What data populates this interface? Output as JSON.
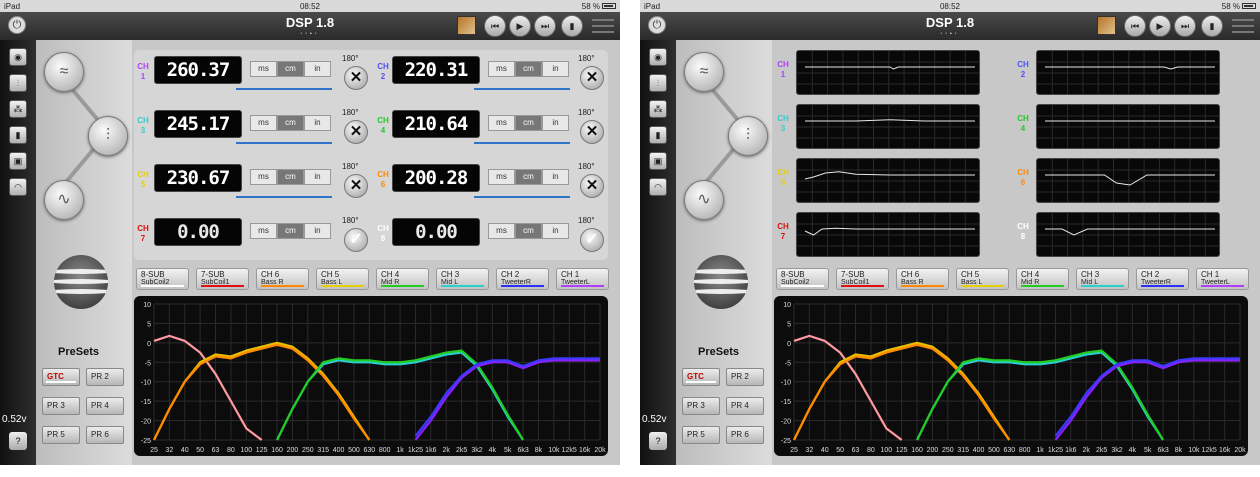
{
  "status": {
    "device": "iPad",
    "time": "08:52",
    "battery": "58 %"
  },
  "app": {
    "title": "DSP 1.8",
    "page_dots": [
      "•",
      "•",
      "•",
      "•"
    ]
  },
  "transport": {
    "prev": "⏮",
    "play": "▶",
    "next": "⏭",
    "extra": "▮"
  },
  "sidebar": {
    "voltage": "0.52v",
    "help": "?"
  },
  "presets": {
    "title": "PreSets",
    "items": [
      "GTC",
      "PR 2",
      "PR 3",
      "PR 4",
      "PR 5",
      "PR 6"
    ]
  },
  "delay": {
    "units": [
      "ms",
      "cm",
      "in"
    ],
    "phase": "180°",
    "channels": [
      {
        "ch": "CH",
        "num": "1",
        "value": "260.37",
        "color": "#b040ff"
      },
      {
        "ch": "CH",
        "num": "2",
        "value": "220.31",
        "color": "#5050ff"
      },
      {
        "ch": "CH",
        "num": "3",
        "value": "245.17",
        "color": "#2ad0d0"
      },
      {
        "ch": "CH",
        "num": "4",
        "value": "210.64",
        "color": "#22cc22"
      },
      {
        "ch": "CH",
        "num": "5",
        "value": "230.67",
        "color": "#e8d000"
      },
      {
        "ch": "CH",
        "num": "6",
        "value": "200.28",
        "color": "#ff8a00"
      },
      {
        "ch": "CH",
        "num": "7",
        "value": "0.00",
        "color": "#e01010"
      },
      {
        "ch": "CH",
        "num": "8",
        "value": "0.00",
        "color": "#ffffff"
      }
    ]
  },
  "tabs": [
    {
      "top": "8-SUB",
      "bottom": "SubCoil2",
      "color": "#ffffff"
    },
    {
      "top": "7-SUB",
      "bottom": "SubCoil1",
      "color": "#e01010"
    },
    {
      "top": "CH 6",
      "bottom": "Bass R",
      "color": "#ff8a00"
    },
    {
      "top": "CH 5",
      "bottom": "Bass L",
      "color": "#e8d000"
    },
    {
      "top": "CH 4",
      "bottom": "Mid R",
      "color": "#22cc22"
    },
    {
      "top": "CH 3",
      "bottom": "Mid L",
      "color": "#2ad0d0"
    },
    {
      "top": "CH 2",
      "bottom": "TweeterR",
      "color": "#3030ff"
    },
    {
      "top": "CH 1",
      "bottom": "TweeterL",
      "color": "#b040ff"
    }
  ],
  "chart_data": {
    "type": "line",
    "x_ticks": [
      "25",
      "32",
      "40",
      "50",
      "63",
      "80",
      "100",
      "125",
      "160",
      "200",
      "250",
      "315",
      "400",
      "500",
      "630",
      "800",
      "1k",
      "1k25",
      "1k6",
      "2k",
      "2k5",
      "3k2",
      "4k",
      "5k",
      "6k3",
      "8k",
      "10k",
      "12k5",
      "16k",
      "20k"
    ],
    "y_ticks": [
      10,
      5,
      0,
      -5,
      -10,
      -15,
      -20,
      -25
    ],
    "ylim": [
      -25,
      10
    ],
    "series": [
      {
        "color": "#ff9aa0",
        "points": [
          [
            0,
            0.5
          ],
          [
            1,
            1.8
          ],
          [
            2,
            0.5
          ],
          [
            3,
            -2.5
          ],
          [
            4,
            -8
          ],
          [
            5,
            -15
          ],
          [
            6,
            -22
          ],
          [
            7,
            -25
          ]
        ]
      },
      {
        "color": "#e8c000",
        "points": [
          [
            0,
            -25
          ],
          [
            1,
            -17
          ],
          [
            2,
            -10
          ],
          [
            3,
            -5
          ],
          [
            4,
            -3
          ],
          [
            5,
            -3.5
          ],
          [
            6,
            -2
          ],
          [
            7,
            -1
          ],
          [
            8,
            0
          ],
          [
            9,
            -1
          ],
          [
            10,
            -4
          ],
          [
            11,
            -8
          ],
          [
            12,
            -13
          ],
          [
            13,
            -19
          ],
          [
            14,
            -25
          ]
        ]
      },
      {
        "color": "#ff8a00",
        "points": [
          [
            0,
            -25
          ],
          [
            1,
            -17
          ],
          [
            2,
            -10
          ],
          [
            3,
            -5.5
          ],
          [
            4,
            -3.5
          ],
          [
            5,
            -4
          ],
          [
            6,
            -2.5
          ],
          [
            7,
            -1.5
          ],
          [
            8,
            -0.5
          ],
          [
            9,
            -1.5
          ],
          [
            10,
            -4.5
          ],
          [
            11,
            -8.5
          ],
          [
            12,
            -13.5
          ],
          [
            13,
            -19.5
          ],
          [
            14,
            -25
          ]
        ]
      },
      {
        "color": "#2ad0d0",
        "points": [
          [
            8,
            -25
          ],
          [
            9,
            -17
          ],
          [
            10,
            -10
          ],
          [
            11,
            -5.5
          ],
          [
            12,
            -4.5
          ],
          [
            13,
            -5
          ],
          [
            14,
            -5
          ],
          [
            15,
            -5.5
          ],
          [
            16,
            -5.5
          ],
          [
            17,
            -5
          ],
          [
            18,
            -4
          ],
          [
            19,
            -3
          ],
          [
            20,
            -2.5
          ],
          [
            21,
            -6
          ],
          [
            22,
            -12
          ],
          [
            23,
            -19
          ],
          [
            24,
            -25
          ]
        ]
      },
      {
        "color": "#22cc22",
        "points": [
          [
            8,
            -25
          ],
          [
            9,
            -17
          ],
          [
            10,
            -10
          ],
          [
            11,
            -5
          ],
          [
            12,
            -4
          ],
          [
            13,
            -4.5
          ],
          [
            14,
            -4.5
          ],
          [
            15,
            -5
          ],
          [
            16,
            -5
          ],
          [
            17,
            -4.5
          ],
          [
            18,
            -3.5
          ],
          [
            19,
            -2.5
          ],
          [
            20,
            -2
          ],
          [
            21,
            -5.5
          ],
          [
            22,
            -11.5
          ],
          [
            23,
            -18.5
          ],
          [
            24,
            -25
          ]
        ]
      },
      {
        "color": "#8a20ff",
        "points": [
          [
            17,
            -25
          ],
          [
            18,
            -20
          ],
          [
            19,
            -14
          ],
          [
            20,
            -9
          ],
          [
            21,
            -6
          ],
          [
            22,
            -5
          ],
          [
            23,
            -5
          ],
          [
            24,
            -6.5
          ],
          [
            25,
            -5
          ],
          [
            26,
            -4.5
          ],
          [
            27,
            -4.5
          ],
          [
            28,
            -4.5
          ],
          [
            29,
            -4.5
          ]
        ]
      },
      {
        "color": "#3a3aff",
        "points": [
          [
            17,
            -24
          ],
          [
            18,
            -19
          ],
          [
            19,
            -13
          ],
          [
            20,
            -8.5
          ],
          [
            21,
            -5.5
          ],
          [
            22,
            -4.5
          ],
          [
            23,
            -4.5
          ],
          [
            24,
            -6
          ],
          [
            25,
            -4.5
          ],
          [
            26,
            -4
          ],
          [
            27,
            -4
          ],
          [
            28,
            -4
          ],
          [
            29,
            -4
          ]
        ]
      }
    ]
  }
}
